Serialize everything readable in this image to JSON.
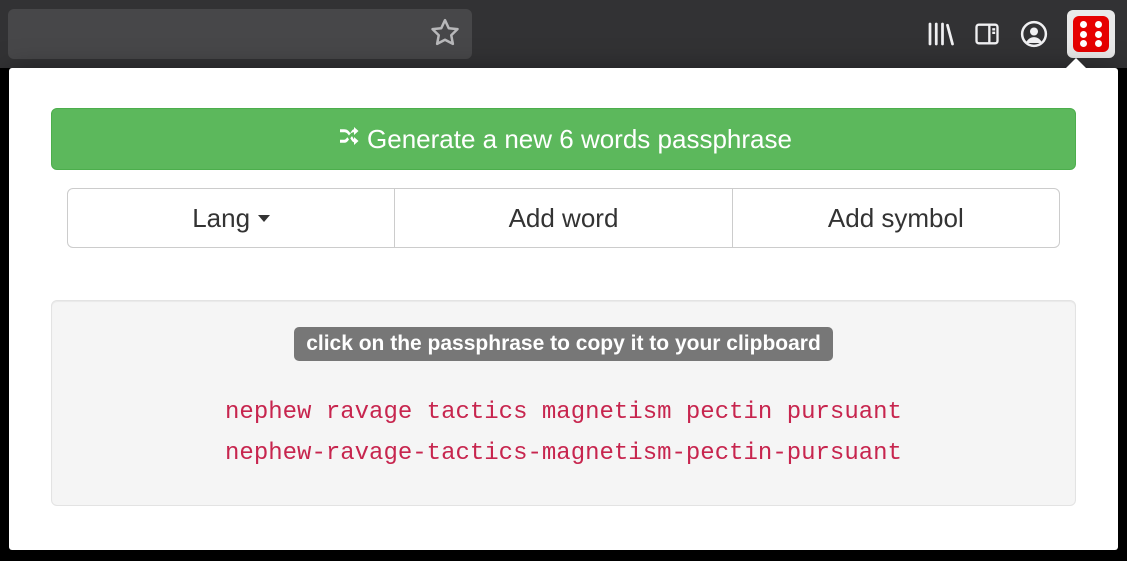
{
  "toolbar": {
    "icons": [
      "library",
      "reader",
      "account",
      "diceware-extension"
    ]
  },
  "popup": {
    "generate_label": "Generate a new 6 words passphrase",
    "buttons": {
      "lang_label": "Lang",
      "add_word_label": "Add word",
      "add_symbol_label": "Add symbol"
    },
    "hint": "click on the passphrase to copy it to your clipboard",
    "passphrases": {
      "spaced": "nephew ravage tactics magnetism pectin pursuant",
      "hyphenated": "nephew-ravage-tactics-magnetism-pectin-pursuant"
    }
  },
  "colors": {
    "accent_green": "#5cb85c",
    "code_red": "#c7254e",
    "dice_red": "#e60000"
  }
}
